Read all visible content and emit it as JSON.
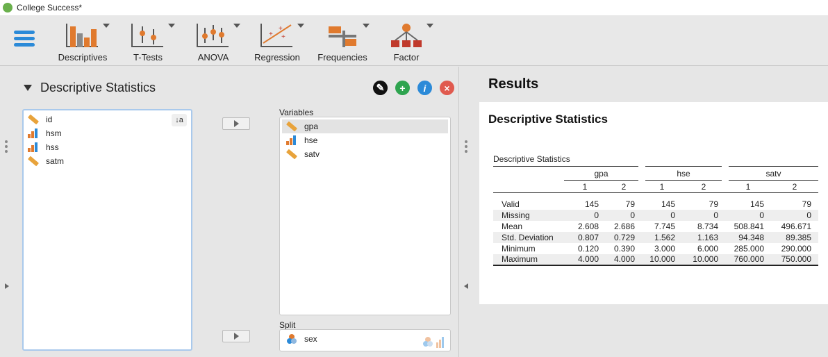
{
  "window": {
    "title": "College Success*"
  },
  "toolbar": {
    "items": [
      {
        "label": "Descriptives",
        "icon": "descriptives-icon"
      },
      {
        "label": "T-Tests",
        "icon": "t-tests-icon"
      },
      {
        "label": "ANOVA",
        "icon": "anova-icon"
      },
      {
        "label": "Regression",
        "icon": "regression-icon"
      },
      {
        "label": "Frequencies",
        "icon": "frequencies-icon"
      },
      {
        "label": "Factor",
        "icon": "factor-icon"
      }
    ]
  },
  "analysis": {
    "title": "Descriptive Statistics",
    "available_vars": [
      {
        "name": "id",
        "type": "continuous"
      },
      {
        "name": "hsm",
        "type": "ordinal"
      },
      {
        "name": "hss",
        "type": "ordinal"
      },
      {
        "name": "satm",
        "type": "continuous"
      }
    ],
    "variables_label": "Variables",
    "variables": [
      {
        "name": "gpa",
        "type": "continuous"
      },
      {
        "name": "hse",
        "type": "ordinal"
      },
      {
        "name": "satv",
        "type": "continuous"
      }
    ],
    "split_label": "Split",
    "split": [
      {
        "name": "sex",
        "type": "nominal"
      }
    ]
  },
  "results": {
    "heading": "Results",
    "section_title": "Descriptive Statistics",
    "table_caption": "Descriptive Statistics",
    "groups": [
      "gpa",
      "hse",
      "satv"
    ],
    "subgroups": [
      "1",
      "2",
      "1",
      "2",
      "1",
      "2"
    ],
    "rows": [
      {
        "label": "Valid",
        "values": [
          "145",
          "79",
          "145",
          "79",
          "145",
          "79"
        ]
      },
      {
        "label": "Missing",
        "values": [
          "0",
          "0",
          "0",
          "0",
          "0",
          "0"
        ]
      },
      {
        "label": "Mean",
        "values": [
          "2.608",
          "2.686",
          "7.745",
          "8.734",
          "508.841",
          "496.671"
        ]
      },
      {
        "label": "Std. Deviation",
        "values": [
          "0.807",
          "0.729",
          "1.562",
          "1.163",
          "94.348",
          "89.385"
        ]
      },
      {
        "label": "Minimum",
        "values": [
          "0.120",
          "0.390",
          "3.000",
          "6.000",
          "285.000",
          "290.000"
        ]
      },
      {
        "label": "Maximum",
        "values": [
          "4.000",
          "4.000",
          "10.000",
          "10.000",
          "760.000",
          "750.000"
        ]
      }
    ]
  },
  "colors": {
    "accent": "#2b8ad8",
    "orange": "#e07a2e",
    "selected": "#e3e3e3"
  }
}
